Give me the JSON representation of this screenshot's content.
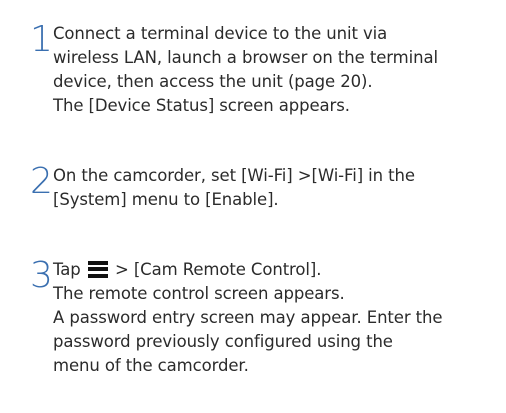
{
  "steps": [
    {
      "number": "1",
      "lines": [
        "Connect a terminal device to the unit via",
        "wireless LAN, launch a browser on the terminal",
        "device, then access the unit (page 20).",
        "The [Device Status] screen appears."
      ]
    },
    {
      "number": "2",
      "lines": [
        "On the camcorder, set [Wi-Fi] >[Wi-Fi] in the",
        "[System] menu to [Enable]."
      ]
    },
    {
      "number": "3",
      "first_line_prefix": "Tap",
      "first_line_suffix": "> [Cam Remote Control].",
      "icon": "menu-icon",
      "lines": [
        "The remote control screen appears.",
        "A password entry screen may appear. Enter the",
        "password previously configured using the",
        "menu of the camcorder."
      ]
    }
  ]
}
